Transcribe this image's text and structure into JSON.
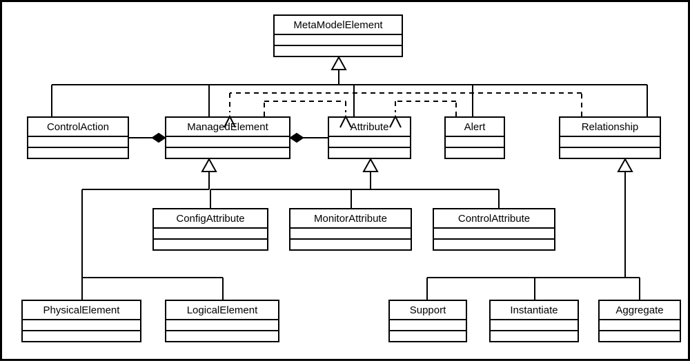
{
  "chart_data": {
    "type": "uml-class-diagram",
    "classes": [
      "MetaModelElement",
      "ControlAction",
      "ManagedElement",
      "Attribute",
      "Alert",
      "Relationship",
      "ConfigAttribute",
      "MonitorAttribute",
      "ControlAttribute",
      "PhysicalElement",
      "LogicalElement",
      "Support",
      "Instantiate",
      "Aggregate"
    ],
    "generalizations": {
      "parent_child": [
        [
          "MetaModelElement",
          "ControlAction"
        ],
        [
          "MetaModelElement",
          "ManagedElement"
        ],
        [
          "MetaModelElement",
          "Attribute"
        ],
        [
          "MetaModelElement",
          "Alert"
        ],
        [
          "MetaModelElement",
          "Relationship"
        ],
        [
          "ManagedElement",
          "PhysicalElement"
        ],
        [
          "ManagedElement",
          "LogicalElement"
        ],
        [
          "Attribute",
          "ConfigAttribute"
        ],
        [
          "Attribute",
          "MonitorAttribute"
        ],
        [
          "Attribute",
          "ControlAttribute"
        ],
        [
          "Relationship",
          "Support"
        ],
        [
          "Relationship",
          "Instantiate"
        ],
        [
          "Relationship",
          "Aggregate"
        ]
      ]
    },
    "compositions": {
      "whole_part": [
        [
          "ManagedElement",
          "ControlAction"
        ],
        [
          "ManagedElement",
          "Attribute"
        ]
      ]
    },
    "dependencies": {
      "from_to": [
        [
          "ManagedElement",
          "Attribute"
        ],
        [
          "Alert",
          "Attribute"
        ],
        [
          "Relationship",
          "ManagedElement"
        ]
      ]
    }
  },
  "boxes": {
    "MetaModelElement": "MetaModelElement",
    "ControlAction": "ControlAction",
    "ManagedElement": "ManagedElement",
    "Attribute": "Attribute",
    "Alert": "Alert",
    "Relationship": "Relationship",
    "ConfigAttribute": "ConfigAttribute",
    "MonitorAttribute": "MonitorAttribute",
    "ControlAttribute": "ControlAttribute",
    "PhysicalElement": "PhysicalElement",
    "LogicalElement": "LogicalElement",
    "Support": "Support",
    "Instantiate": "Instantiate",
    "Aggregate": "Aggregate"
  }
}
